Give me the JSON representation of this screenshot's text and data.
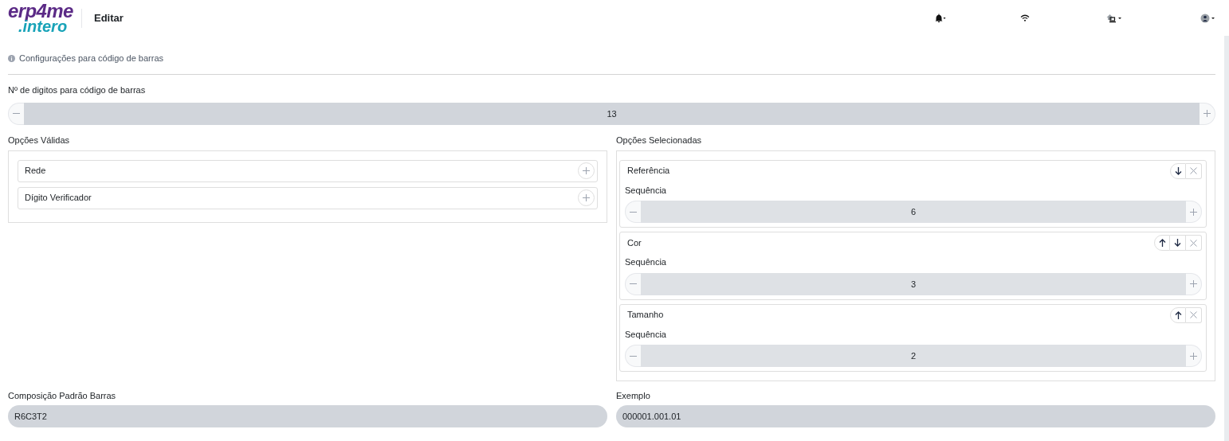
{
  "header": {
    "logo_top": "erp4me",
    "logo_bottom": ".intero",
    "title": "Editar"
  },
  "info": "Configurações para código de barras",
  "digits": {
    "label": "Nº de digitos para código de barras",
    "value": "13"
  },
  "valid_options": {
    "title": "Opções Válidas",
    "items": [
      {
        "label": "Rede"
      },
      {
        "label": "Dígito Verificador"
      }
    ]
  },
  "selected_options": {
    "title": "Opções Selecionadas",
    "items": [
      {
        "label": "Referência",
        "can_move_up": false,
        "can_move_down": true,
        "sequence_label": "Sequência",
        "sequence": "6"
      },
      {
        "label": "Cor",
        "can_move_up": true,
        "can_move_down": true,
        "sequence_label": "Sequência",
        "sequence": "3"
      },
      {
        "label": "Tamanho",
        "can_move_up": true,
        "can_move_down": false,
        "sequence_label": "Sequência",
        "sequence": "2"
      }
    ]
  },
  "composition": {
    "label": "Composição Padrão Barras",
    "value": "R6C3T2"
  },
  "example": {
    "label": "Exemplo",
    "value": "000001.001.01"
  }
}
